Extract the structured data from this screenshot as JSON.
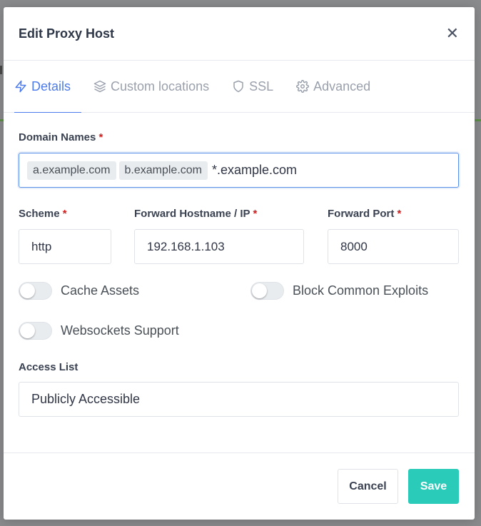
{
  "modal": {
    "title": "Edit Proxy Host",
    "close_icon": "close-icon"
  },
  "tabs": [
    {
      "label": "Details",
      "icon": "lightning-icon",
      "active": true
    },
    {
      "label": "Custom locations",
      "icon": "layers-icon",
      "active": false
    },
    {
      "label": "SSL",
      "icon": "shield-icon",
      "active": false
    },
    {
      "label": "Advanced",
      "icon": "gear-icon",
      "active": false
    }
  ],
  "domain_names": {
    "label": "Domain Names",
    "required_mark": "*",
    "chips": [
      "a.example.com",
      "b.example.com"
    ],
    "typed_value": "*.example.com"
  },
  "scheme": {
    "label": "Scheme",
    "required_mark": "*",
    "value": "http"
  },
  "forward_host": {
    "label": "Forward Hostname / IP",
    "required_mark": "*",
    "value": "192.168.1.103"
  },
  "forward_port": {
    "label": "Forward Port",
    "required_mark": "*",
    "value": "8000"
  },
  "toggles": {
    "cache_assets": {
      "label": "Cache Assets",
      "on": false
    },
    "block_exploits": {
      "label": "Block Common Exploits",
      "on": false
    },
    "websockets": {
      "label": "Websockets Support",
      "on": false
    }
  },
  "access_list": {
    "label": "Access List",
    "value": "Publicly Accessible"
  },
  "footer": {
    "cancel_label": "Cancel",
    "save_label": "Save"
  },
  "colors": {
    "accent": "#4b7bec",
    "save": "#2bcbba",
    "required": "#cd201f"
  }
}
